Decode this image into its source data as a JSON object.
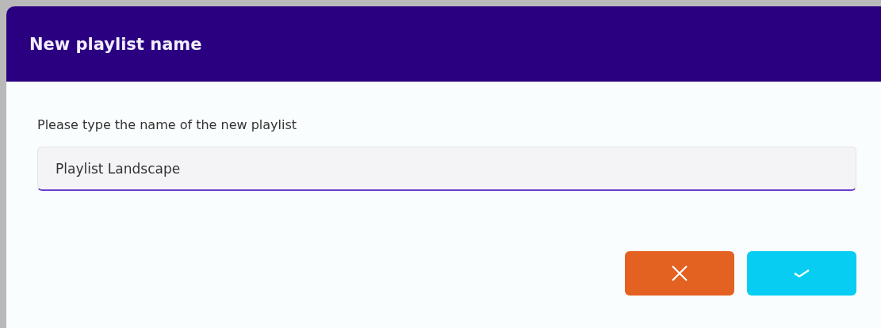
{
  "dialog": {
    "title": "New playlist name",
    "prompt": "Please type the name of the new playlist",
    "input": {
      "value": "Playlist Landscape"
    },
    "buttons": [
      {
        "kind": "cancel"
      },
      {
        "kind": "confirm"
      }
    ]
  }
}
